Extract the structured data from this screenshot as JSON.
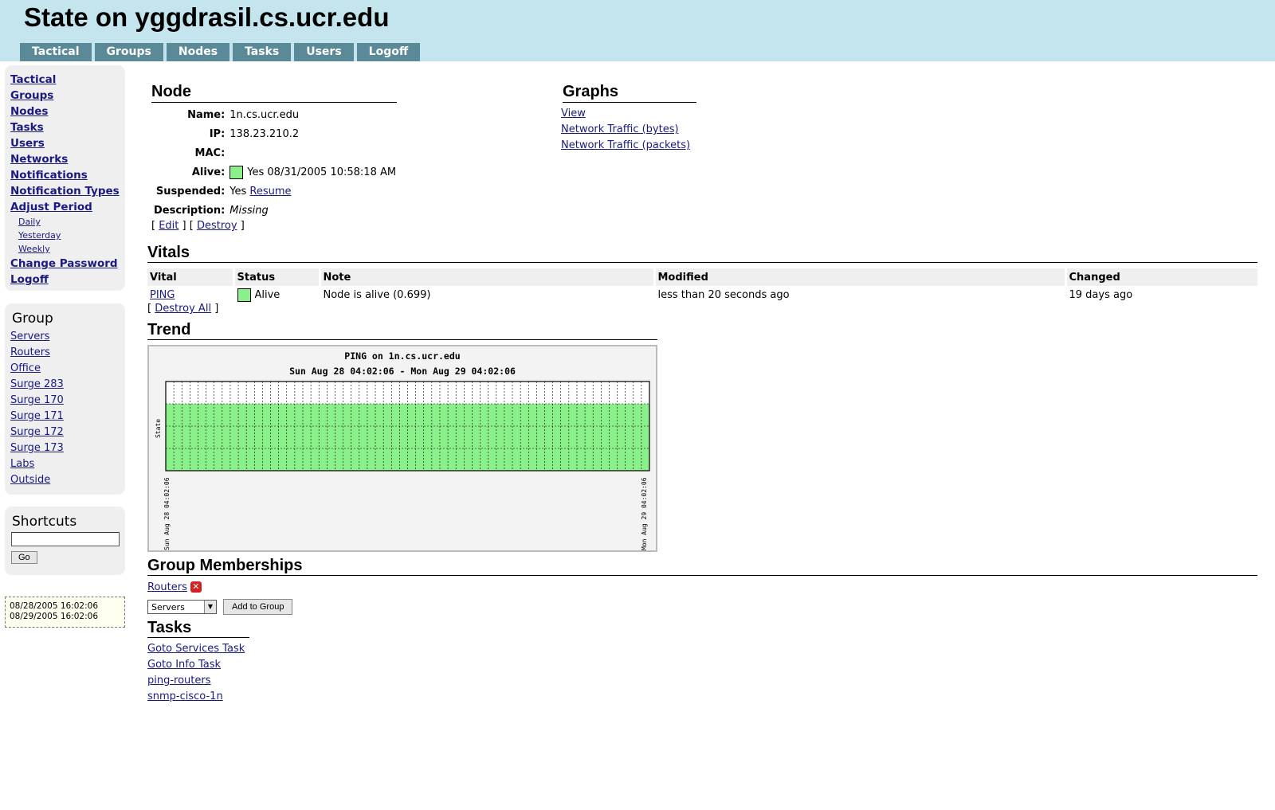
{
  "header": {
    "title": "State on yggdrasil.cs.ucr.edu",
    "tabs": [
      "Tactical",
      "Groups",
      "Nodes",
      "Tasks",
      "Users",
      "Logoff"
    ]
  },
  "sidebar": {
    "nav": [
      "Tactical",
      "Groups",
      "Nodes",
      "Tasks",
      "Users",
      "Networks",
      "Notifications",
      "Notification Types",
      "Adjust Period"
    ],
    "period_links": [
      "Daily",
      "Yesterday",
      "Weekly"
    ],
    "nav_bottom": [
      "Change Password",
      "Logoff"
    ],
    "group_title": "Group",
    "groups": [
      "Servers",
      "Routers",
      "Office",
      "Surge 283",
      "Surge 170",
      "Surge 171",
      "Surge 172",
      "Surge 173",
      "Labs",
      "Outside"
    ],
    "shortcuts_title": "Shortcuts",
    "shortcut_value": "",
    "go_label": "Go",
    "period": {
      "start": "08/28/2005 16:02:06",
      "end": "08/29/2005 16:02:06"
    }
  },
  "node": {
    "title": "Node",
    "labels": {
      "name": "Name:",
      "ip": "IP:",
      "mac": "MAC:",
      "alive": "Alive:",
      "suspended": "Suspended:",
      "description": "Description:"
    },
    "name": "1n.cs.ucr.edu",
    "ip": "138.23.210.2",
    "mac": "",
    "alive_text": "Yes 08/31/2005 10:58:18 AM",
    "suspended_text": "Yes",
    "resume_label": "Resume",
    "description": "Missing",
    "edit_label": "Edit",
    "destroy_label": "Destroy",
    "open_bracket": "[",
    "close_bracket": "]"
  },
  "graphs": {
    "title": "Graphs",
    "links": [
      "View",
      "Network Traffic (bytes)",
      "Network Traffic (packets)"
    ]
  },
  "vitals": {
    "title": "Vitals",
    "columns": [
      "Vital",
      "Status",
      "Note",
      "Modified",
      "Changed"
    ],
    "row": {
      "vital": "PING",
      "status": "Alive",
      "note": "Node is alive (0.699)",
      "modified": "less than 20 seconds ago",
      "changed": "19 days ago"
    },
    "destroy_all_label": "Destroy All"
  },
  "trend": {
    "title": "Trend"
  },
  "chart_data": {
    "type": "area",
    "title": "PING on 1n.cs.ucr.edu",
    "subtitle": "Sun Aug 28 04:02:06 - Mon Aug 29 04:02:06",
    "ylabel": "State",
    "x_tick_labels": [
      "Sun Aug 28 04:02:06",
      "Mon Aug 29 04:02:06"
    ],
    "fill_fraction": 0.75,
    "fill_color": "#8af08a",
    "grid": true
  },
  "memberships": {
    "title": "Group Memberships",
    "groups": [
      "Routers"
    ],
    "select_value": "Servers",
    "add_label": "Add to Group"
  },
  "tasks": {
    "title": "Tasks",
    "items": [
      "Goto Services Task",
      "Goto Info Task",
      "ping-routers",
      "snmp-cisco-1n"
    ]
  },
  "colors": {
    "header_bg": "#c4e5ee",
    "tab_bg": "#5a8a98",
    "alive": "#8af08a",
    "link": "#1a1a80"
  }
}
